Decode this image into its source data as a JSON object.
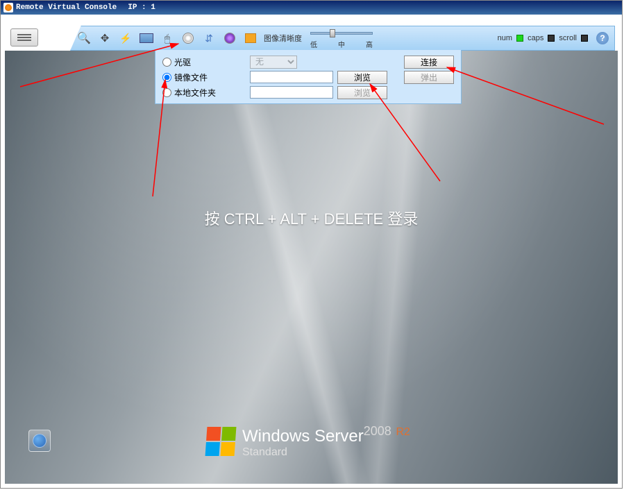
{
  "title_bar": {
    "app_title": "Remote Virtual Console",
    "ip_label": "IP : 1"
  },
  "toolbar": {
    "clarity_label": "图像清晰度",
    "slider_labels": {
      "low": "低",
      "mid": "中",
      "high": "高"
    },
    "status": {
      "num": "num",
      "caps": "caps",
      "scroll": "scroll"
    },
    "help": "?"
  },
  "media_panel": {
    "radio_cddrive": "光驱",
    "radio_image": "镜像文件",
    "radio_folder": "本地文件夹",
    "select_none": "无",
    "btn_browse": "浏览",
    "btn_connect": "连接",
    "btn_eject": "弹出"
  },
  "desktop": {
    "login_prompt": "按 CTRL + ALT + DELETE 登录",
    "brand_main": "Windows Server",
    "brand_year": "2008",
    "brand_r2": "R2",
    "brand_edition": "Standard"
  }
}
